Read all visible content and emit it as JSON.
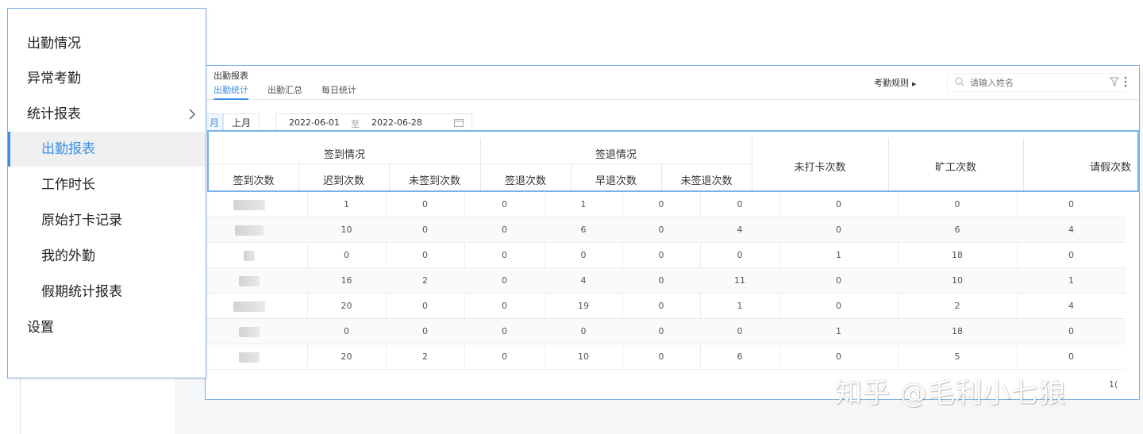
{
  "menu": {
    "items": [
      {
        "label": "出勤情况"
      },
      {
        "label": "异常考勤"
      },
      {
        "label": "统计报表"
      },
      {
        "label": "出勤报表"
      },
      {
        "label": "工作时长"
      },
      {
        "label": "原始打卡记录"
      },
      {
        "label": "我的外勤"
      },
      {
        "label": "假期统计报表"
      },
      {
        "label": "设置"
      }
    ]
  },
  "report": {
    "title": "出勤报表",
    "tabs": [
      "出勤统计",
      "出勤汇总",
      "每日统计"
    ],
    "rules_label": "考勤规则",
    "search_placeholder": "请输入姓名",
    "range_current": "月",
    "range_prev": "上月",
    "date_from": "2022-06-01",
    "date_sep": "至",
    "date_to": "2022-06-28"
  },
  "table": {
    "group_signin": "签到情况",
    "group_signout": "签退情况",
    "cols": {
      "signin_count": "签到次数",
      "late_count": "迟到次数",
      "no_signin_count": "未签到次数",
      "signout_count": "签退次数",
      "early_count": "早退次数",
      "no_signout_count": "未签退次数",
      "missed_punch": "未打卡次数",
      "absent": "旷工次数",
      "leave": "请假次数"
    },
    "rows": [
      [
        "1",
        "0",
        "0",
        "1",
        "0",
        "0",
        "0",
        "0",
        "0"
      ],
      [
        "10",
        "0",
        "0",
        "6",
        "0",
        "4",
        "0",
        "6",
        "4"
      ],
      [
        "0",
        "0",
        "0",
        "0",
        "0",
        "0",
        "1",
        "18",
        "0"
      ],
      [
        "16",
        "2",
        "0",
        "4",
        "0",
        "11",
        "0",
        "10",
        "1"
      ],
      [
        "20",
        "0",
        "0",
        "19",
        "0",
        "1",
        "0",
        "2",
        "4"
      ],
      [
        "0",
        "0",
        "0",
        "0",
        "0",
        "0",
        "1",
        "18",
        "0"
      ],
      [
        "20",
        "2",
        "0",
        "10",
        "0",
        "6",
        "0",
        "5",
        "0"
      ]
    ],
    "footer_value": "1("
  },
  "watermark": "知乎 @毛利小七狼",
  "colors": {
    "accent": "#3a8ee6",
    "highlight_border": "#7db3e3"
  }
}
